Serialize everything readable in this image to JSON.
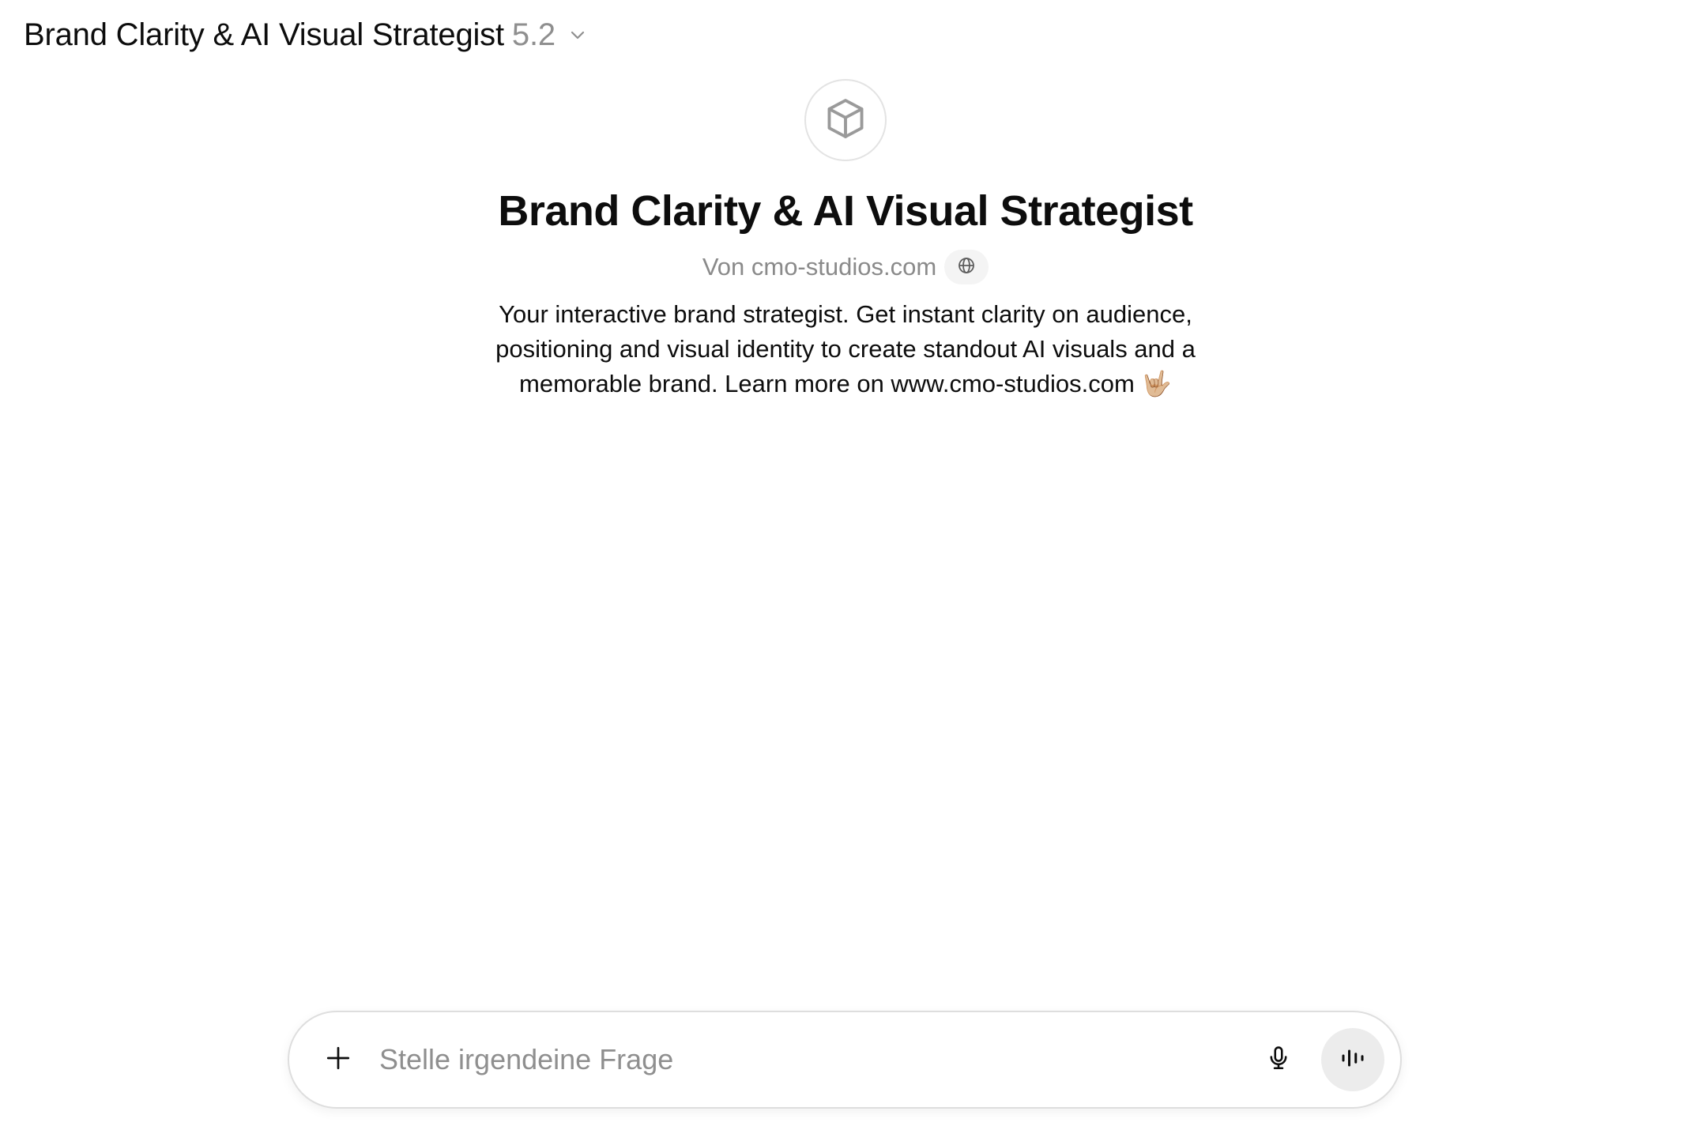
{
  "header": {
    "gpt_name": "Brand Clarity & AI Visual Strategist",
    "model_version": "5.2",
    "dropdown_icon": "chevron-down-icon"
  },
  "hero": {
    "avatar_icon": "cube-icon",
    "title": "Brand Clarity & AI Visual Strategist",
    "byline": "Von cmo-studios.com",
    "website_icon": "globe-icon",
    "description": "Your interactive brand strategist. Get instant clarity on audience, positioning and visual identity to create standout AI visuals and a memorable brand. Learn more on www.cmo-studios.com 🤟🏼"
  },
  "composer": {
    "placeholder": "Stelle irgendeine Frage",
    "value": "",
    "attach_icon": "plus-icon",
    "dictate_icon": "microphone-icon",
    "voice_icon": "voice-waveform-icon"
  },
  "colors": {
    "text_primary": "#0d0d0d",
    "text_secondary": "#8f8f8f",
    "border": "#dedede",
    "chip_bg": "#f4f4f4",
    "voice_btn_bg": "#ececec"
  }
}
